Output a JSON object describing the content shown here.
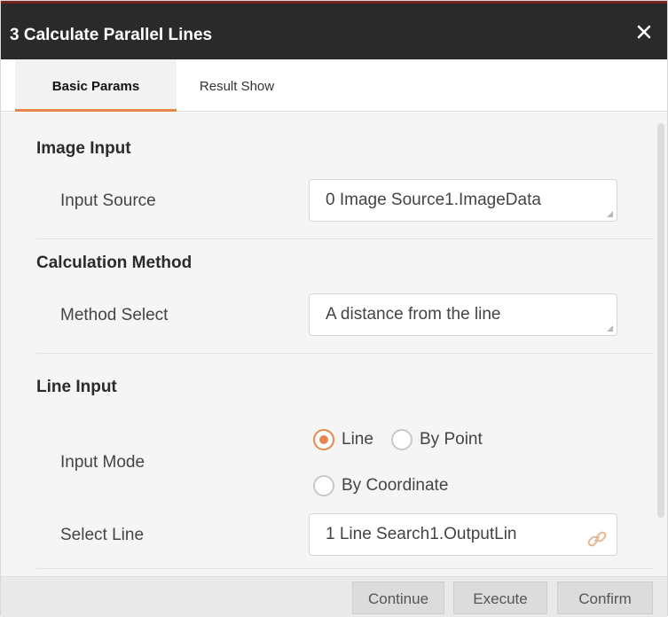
{
  "window": {
    "title": "3 Calculate Parallel Lines",
    "close_icon": "close-icon"
  },
  "tabs": [
    {
      "label": "Basic Params",
      "active": true
    },
    {
      "label": "Result Show",
      "active": false
    }
  ],
  "sections": {
    "image_input": {
      "title": "Image Input",
      "input_source_label": "Input Source",
      "input_source_value": "0 Image Source1.ImageData"
    },
    "calculation_method": {
      "title": "Calculation Method",
      "method_select_label": "Method Select",
      "method_select_value": "A distance from the line"
    },
    "line_input": {
      "title": "Line Input",
      "input_mode_label": "Input Mode",
      "input_mode_options": [
        {
          "label": "Line",
          "checked": true
        },
        {
          "label": "By Point",
          "checked": false
        },
        {
          "label": "By Coordinate",
          "checked": false
        }
      ],
      "select_line_label": "Select Line",
      "select_line_value": "1 Line Search1.OutputLin",
      "select_line_icon": "link-icon"
    }
  },
  "footer": {
    "continue_label": "Continue",
    "execute_label": "Execute",
    "confirm_label": "Confirm"
  },
  "colors": {
    "title_bar": "#2a2a2a",
    "accent": "#e4874a",
    "content_bg": "#f5f5f5"
  }
}
